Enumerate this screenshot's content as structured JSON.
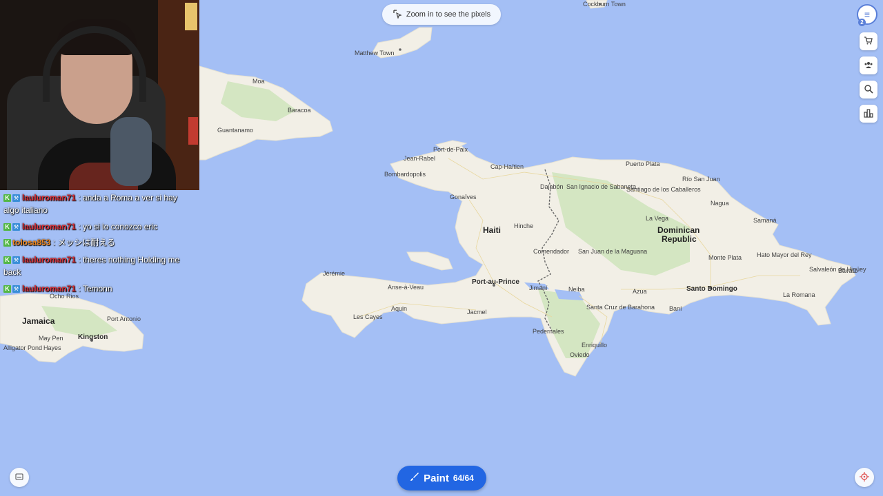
{
  "toolbar": {
    "zoom_hint": "Zoom in to see the pixels",
    "paint_label": "Paint",
    "paint_count": "64/64"
  },
  "brand": {
    "badge": "2",
    "logo_letter": "≡"
  },
  "colors": {
    "ocean": "#a4bff5",
    "land": "#f2efe6",
    "paint_button": "#2266e3",
    "accent": "#5a7fd8"
  },
  "icons": {
    "zoom": "zoom-pointer-icon",
    "paint": "brush-icon",
    "side_buttons": [
      "cart-icon",
      "users-icon",
      "search-globe-icon",
      "leaderboard-icon"
    ],
    "bottom_left": "keyboard-icon",
    "bottom_right": "locate-icon"
  },
  "chat": {
    "messages": [
      {
        "user": "lauluroman71",
        "text": ": anda a Roma a ver si hay algo italiano"
      },
      {
        "user": "lauluroman71",
        "text": ": yo si lo conozco eric"
      },
      {
        "user": "tolosa853",
        "text": ": メッシは耐える"
      },
      {
        "user": "lauluroman71",
        "text": ": theres nothing Holding me back"
      },
      {
        "user": "lauluroman71",
        "text": ": Temonn"
      }
    ]
  },
  "map": {
    "countries": [
      "Haiti",
      "Dominican",
      "Republic",
      "Jamaica"
    ],
    "capitals": [
      "Port-au-Prince",
      "Santo Domingo",
      "Kingston"
    ],
    "places": [
      "Cockburn Town",
      "Matthew Town",
      "Moa",
      "Baracoa",
      "Guantanamo",
      "Port-de-Paix",
      "Jean-Rabel",
      "Cap-Haïtien",
      "Bombardopolis",
      "Puerto Plata",
      "Río San Juan",
      "Dajabón",
      "San Ignacio de Sabaneta",
      "Santiago de los Caballeros",
      "Nagua",
      "Gonaïves",
      "Samaná",
      "Hinche",
      "La Vega",
      "Comendador",
      "San Juan de la Maguana",
      "Monte Plata",
      "Hato Mayor del Rey",
      "Jérémie",
      "Anse-à-Veau",
      "Salvaleón de Higüey",
      "Bávaro",
      "Les Cayes",
      "Aquin",
      "Jacmel",
      "Jimaní",
      "Neiba",
      "Azua",
      "Santa Cruz de Barahona",
      "Baní",
      "La Romana",
      "Pedernales",
      "Enriquillo",
      "Oviedo",
      "Ocho Rios",
      "Port Antonio",
      "May Pen",
      "Hayes",
      "Alligator Pond"
    ]
  }
}
